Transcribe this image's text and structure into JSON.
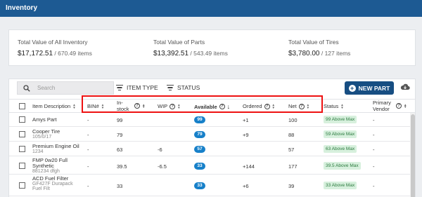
{
  "header": {
    "title": "Inventory"
  },
  "summary": [
    {
      "label": "Total Value of All Inventory",
      "value": "$17,172.51",
      "sub": " / 670.49 items"
    },
    {
      "label": "Total Value of Parts",
      "value": "$13,392.51",
      "sub": " / 543.49 items"
    },
    {
      "label": "Total Value of Tires",
      "value": "$3,780.00",
      "sub": " / 127 items"
    }
  ],
  "toolbar": {
    "search_placeholder": "Search",
    "item_type": "ITEM TYPE",
    "status": "STATUS",
    "new_part": "NEW PART"
  },
  "columns": {
    "item_description": "Item Description",
    "bin": "BIN#",
    "in_stock": "In-stock",
    "wip": "WIP",
    "available": "Available",
    "ordered": "Ordered",
    "net": "Net",
    "status": "Status",
    "primary_vendor": "Primary Vendor"
  },
  "rows": [
    {
      "name": "Amys Part",
      "sub": "",
      "bin": "-",
      "in_stock": "99",
      "wip": "",
      "available": "99",
      "ordered": "+1",
      "net": "100",
      "status": "99 Above Max",
      "vendor": "-"
    },
    {
      "name": "Cooper Tire",
      "sub": "105/0/17",
      "bin": "-",
      "in_stock": "79",
      "wip": "",
      "available": "79",
      "ordered": "+9",
      "net": "88",
      "status": "59 Above Max",
      "vendor": "-"
    },
    {
      "name": "Premium Engine Oil",
      "sub": "1234",
      "bin": "-",
      "in_stock": "63",
      "wip": "-6",
      "available": "57",
      "ordered": "",
      "net": "57",
      "status": "63 Above Max",
      "vendor": "-"
    },
    {
      "name": "FMP 0w20 Full Synthetic",
      "sub": "881234 dfgh",
      "bin": "-",
      "in_stock": "39.5",
      "wip": "-6.5",
      "available": "33",
      "ordered": "+144",
      "net": "177",
      "status": "39.5 Above Max",
      "vendor": "-"
    },
    {
      "name": "ACD Fuel Filter",
      "sub": "GF427F Durapack Fuel Filt",
      "bin": "-",
      "in_stock": "33",
      "wip": "",
      "available": "33",
      "ordered": "+6",
      "net": "39",
      "status": "33 Above Max",
      "vendor": "-"
    }
  ],
  "colors": {
    "header": "#1d5a93",
    "button": "#174e82",
    "available_pill": "#1780c9",
    "status_bg": "#d7f0dd",
    "status_text": "#2b7a3e",
    "highlight": "#e11111"
  },
  "icons": {
    "search": "search-icon",
    "filter": "filter-lines-icon",
    "add": "plus-circle-icon",
    "download": "cloud-download-icon",
    "info": "info-icon",
    "sort": "sort-icon",
    "sort_desc": "arrow-down-icon"
  }
}
